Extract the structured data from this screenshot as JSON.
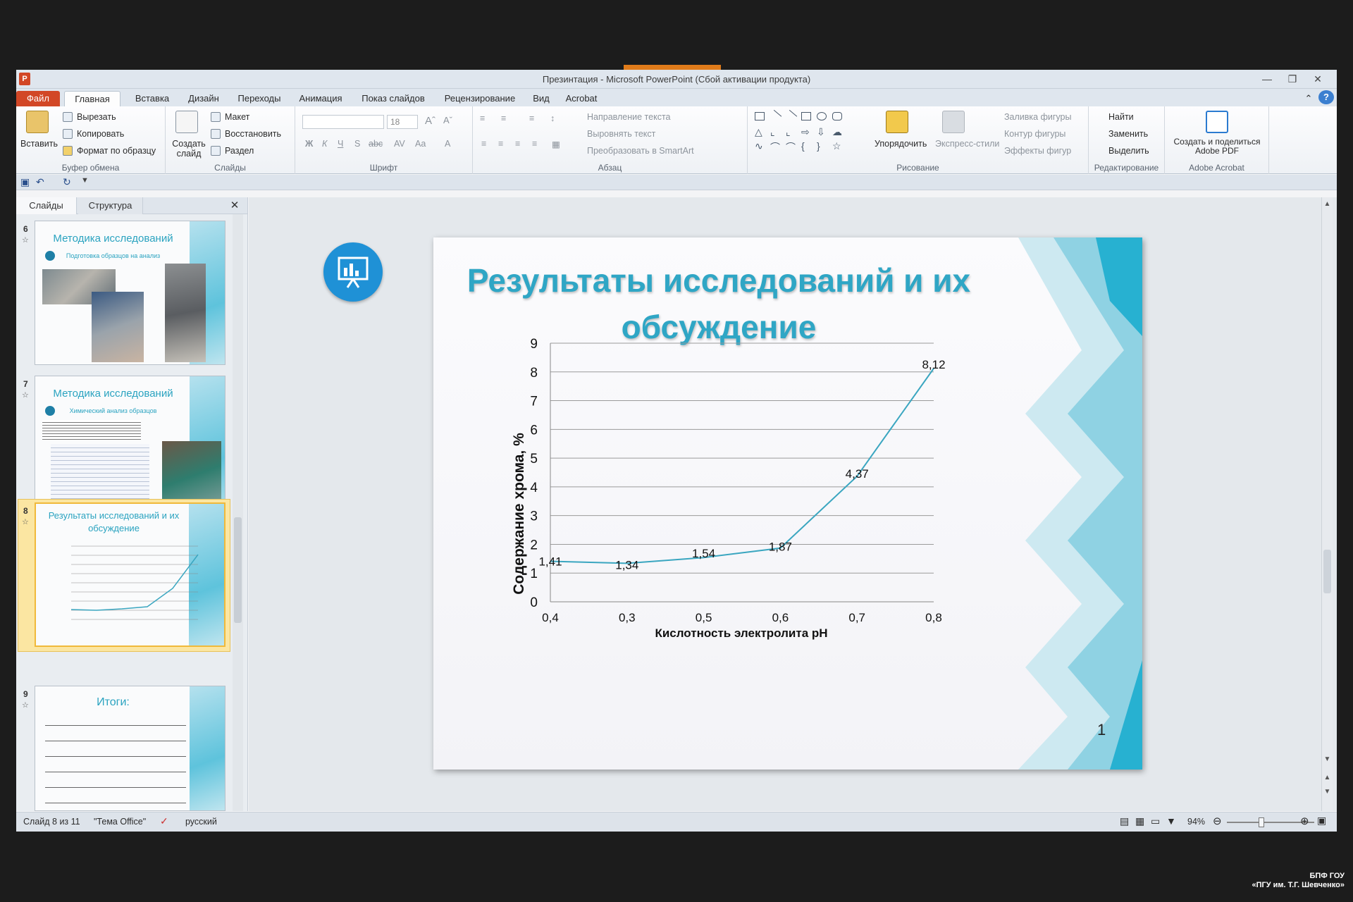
{
  "window": {
    "title": "Презинтация - Microsoft PowerPoint (Сбой активации продукта)"
  },
  "tabs": [
    "Файл",
    "Главная",
    "Вставка",
    "Дизайн",
    "Переходы",
    "Анимация",
    "Показ слайдов",
    "Рецензирование",
    "Вид",
    "Acrobat"
  ],
  "ribbon": {
    "clipboard": {
      "label": "Буфер обмена",
      "paste": "Вставить",
      "cut": "Вырезать",
      "copy": "Копировать",
      "format": "Формат по образцу"
    },
    "slides": {
      "label": "Слайды",
      "new": "Создать слайд",
      "layout": "Макет",
      "reset": "Восстановить",
      "section": "Раздел"
    },
    "font": {
      "label": "Шрифт",
      "size": "18"
    },
    "paragraph": {
      "label": "Абзац",
      "direction": "Направление текста",
      "align": "Выровнять текст",
      "smartart": "Преобразовать в SmartArt"
    },
    "drawing": {
      "label": "Рисование",
      "arrange": "Упорядочить",
      "styles": "Экспресс-стили",
      "fill": "Заливка фигуры",
      "outline": "Контур фигуры",
      "effects": "Эффекты фигур"
    },
    "editing": {
      "label": "Редактирование",
      "find": "Найти",
      "replace": "Заменить",
      "select": "Выделить"
    },
    "acrobat": {
      "label": "Adobe Acrobat",
      "create": "Создать и поделиться Adobe PDF"
    }
  },
  "panel": {
    "tabs": [
      "Слайды",
      "Структура"
    ],
    "thumbs": [
      {
        "num": "6",
        "title": "Методика исследований",
        "sub": "Подготовка образцов на анализ"
      },
      {
        "num": "7",
        "title": "Методика исследований",
        "sub": "Химический анализ образцов"
      },
      {
        "num": "8",
        "title": "Результаты исследований и их обсуждение",
        "sub": ""
      },
      {
        "num": "9",
        "title": "Итоги:",
        "sub": ""
      }
    ]
  },
  "slide": {
    "title": "Результаты исследований и их обсуждение",
    "number": "1"
  },
  "chart_data": {
    "type": "line",
    "categories": [
      "0,4",
      "0,3",
      "0,5",
      "0,6",
      "0,7",
      "0,8"
    ],
    "values": [
      1.41,
      1.34,
      1.54,
      1.87,
      4.37,
      8.12
    ],
    "labels": [
      "1,41",
      "1,34",
      "1,54",
      "1,87",
      "4,37",
      "8,12"
    ],
    "xlabel": "Кислотность электролита pH",
    "ylabel": "Содержание хрома, %",
    "ylim": [
      0,
      9
    ],
    "yticks": [
      "0",
      "1",
      "2",
      "3",
      "4",
      "5",
      "6",
      "7",
      "8",
      "9"
    ],
    "grid": true,
    "line_color": "#3aa6c0"
  },
  "status": {
    "slide": "Слайд 8 из 11",
    "theme": "\"Тема Office\"",
    "lang": "русский",
    "zoom": "94%"
  },
  "watermark": {
    "line1": "БПФ ГОУ",
    "line2": "«ПГУ им. Т.Г. Шевченко»"
  }
}
